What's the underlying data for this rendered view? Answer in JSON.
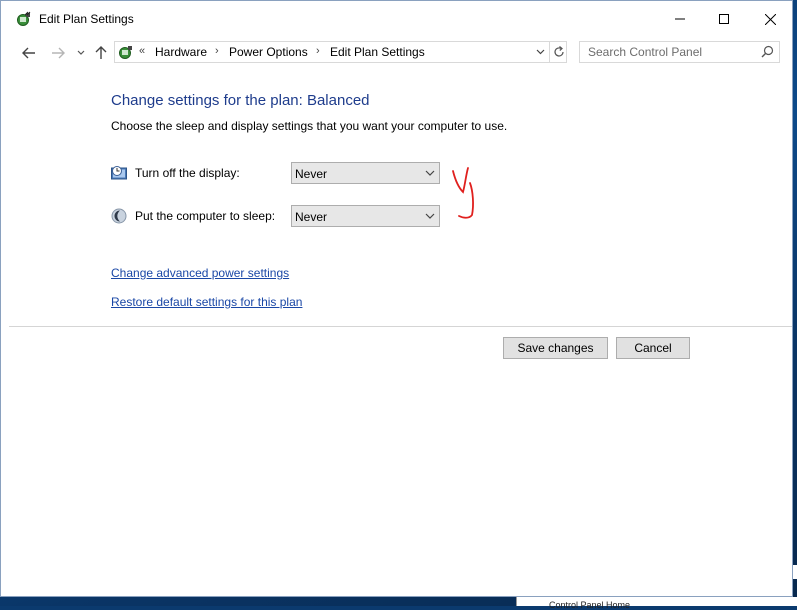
{
  "window": {
    "title": "Edit Plan Settings",
    "icon": "power-options-icon"
  },
  "titlebar_buttons": [
    "minimize",
    "maximize",
    "close"
  ],
  "navigation": {
    "back": "back-arrow-icon",
    "forward": "forward-arrow-icon",
    "recent": "chevron-down-icon",
    "up": "up-arrow-icon"
  },
  "address_bar": {
    "overflow": "«",
    "separator": "›",
    "breadcrumbs": [
      "Hardware",
      "Power Options",
      "Edit Plan Settings"
    ]
  },
  "search": {
    "placeholder": "Search Control Panel"
  },
  "main": {
    "heading": "Change settings for the plan: Balanced",
    "description": "Choose the sleep and display settings that you want your computer to use.",
    "settings": [
      {
        "label": "Turn off the display:",
        "value": "Never",
        "icon": "monitor-clock-icon"
      },
      {
        "label": "Put the computer to sleep:",
        "value": "Never",
        "icon": "moon-icon"
      }
    ],
    "links": {
      "advanced": "Change advanced power settings",
      "restore": "Restore default settings for this plan"
    }
  },
  "footer": {
    "save_label": "Save changes",
    "cancel_label": "Cancel"
  },
  "background_window": {
    "text": "Control Panel Home",
    "edge_text": "n"
  },
  "colors": {
    "heading": "#1e3c8c",
    "link": "#1a47a6",
    "annotation": "#e0201e"
  }
}
